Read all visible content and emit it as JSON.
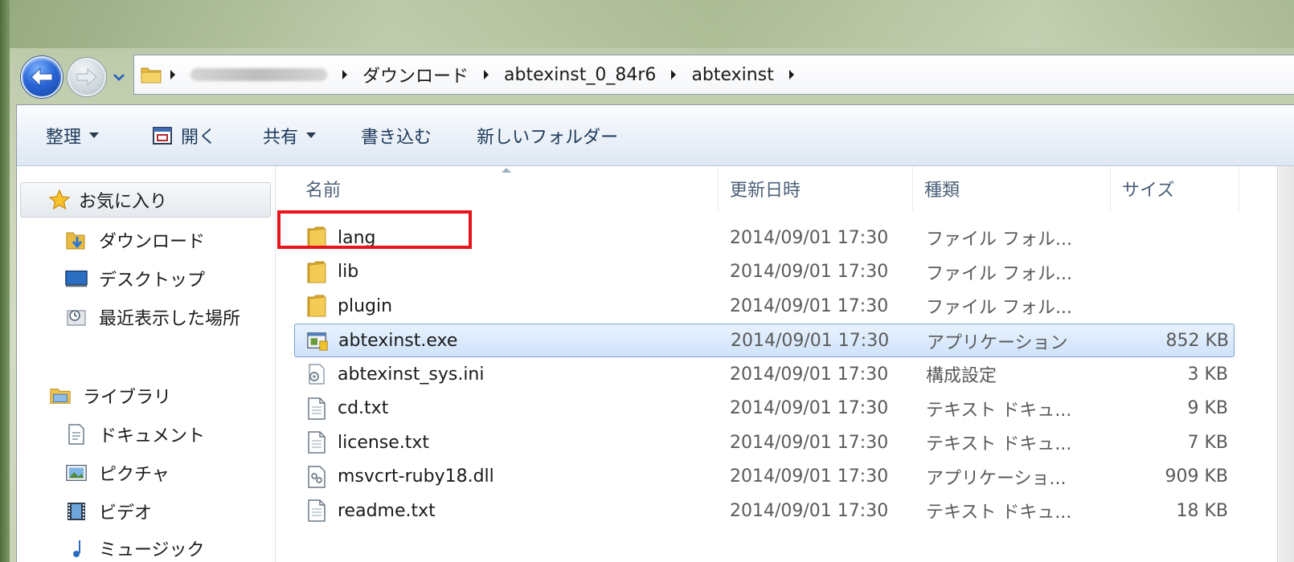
{
  "breadcrumb": {
    "items": [
      "ダウンロード",
      "abtexinst_0_84r6",
      "abtexinst"
    ]
  },
  "toolbar": {
    "organize": "整理",
    "open": "開く",
    "share": "共有",
    "burn": "書き込む",
    "new_folder": "新しいフォルダー"
  },
  "sidebar": {
    "favorites": "お気に入り",
    "downloads": "ダウンロード",
    "desktop": "デスクトップ",
    "recent": "最近表示した場所",
    "libraries": "ライブラリ",
    "documents": "ドキュメント",
    "pictures": "ピクチャ",
    "videos": "ビデオ",
    "music": "ミュージック"
  },
  "columns": {
    "name": "名前",
    "date": "更新日時",
    "type": "種類",
    "size": "サイズ"
  },
  "files": [
    {
      "name": "lang",
      "date": "2014/09/01 17:30",
      "type": "ファイル フォル...",
      "size": "",
      "icon": "folder"
    },
    {
      "name": "lib",
      "date": "2014/09/01 17:30",
      "type": "ファイル フォル...",
      "size": "",
      "icon": "folder"
    },
    {
      "name": "plugin",
      "date": "2014/09/01 17:30",
      "type": "ファイル フォル...",
      "size": "",
      "icon": "folder"
    },
    {
      "name": "abtexinst.exe",
      "date": "2014/09/01 17:30",
      "type": "アプリケーション",
      "size": "852 KB",
      "icon": "exe"
    },
    {
      "name": "abtexinst_sys.ini",
      "date": "2014/09/01 17:30",
      "type": "構成設定",
      "size": "3 KB",
      "icon": "ini"
    },
    {
      "name": "cd.txt",
      "date": "2014/09/01 17:30",
      "type": "テキスト ドキュ...",
      "size": "9 KB",
      "icon": "txt"
    },
    {
      "name": "license.txt",
      "date": "2014/09/01 17:30",
      "type": "テキスト ドキュ...",
      "size": "7 KB",
      "icon": "txt"
    },
    {
      "name": "msvcrt-ruby18.dll",
      "date": "2014/09/01 17:30",
      "type": "アプリケーショ...",
      "size": "909 KB",
      "icon": "dll"
    },
    {
      "name": "readme.txt",
      "date": "2014/09/01 17:30",
      "type": "テキスト ドキュ...",
      "size": "18 KB",
      "icon": "txt"
    }
  ],
  "colors": {
    "highlight": "#e8141b",
    "selection": "#cfe3fb"
  }
}
